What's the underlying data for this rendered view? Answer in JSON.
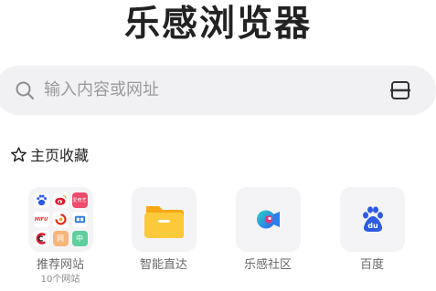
{
  "app": {
    "brand": "乐感浏览器"
  },
  "search": {
    "placeholder": "输入内容或网址",
    "search_icon": "search-icon",
    "scan_icon": "scan-icon"
  },
  "favorites": {
    "title": "主页收藏",
    "icon": "star-outline-icon",
    "items": [
      {
        "label": "推荐网站",
        "sublabel": "10个网站",
        "icon": "site-grid-icon",
        "mini_icons": [
          "baidu-mini-icon",
          "weibo-mini-icon",
          "iqiyi-mini-icon",
          "mini-site-icon",
          "mini-site-icon",
          "mini-site-icon",
          "mini-site-icon",
          "mini-site-icon",
          "mini-site-icon"
        ],
        "mini_texts": {
          "iqiyi": "爱奇艺",
          "mini4": "MIFU",
          "m8": "网",
          "m9": "中"
        }
      },
      {
        "label": "智能直达",
        "icon": "folder-icon"
      },
      {
        "label": "乐感社区",
        "icon": "community-icon"
      },
      {
        "label": "百度",
        "icon": "baidu-paw-icon"
      }
    ]
  },
  "colors": {
    "background": "#ffffff",
    "search_bg": "#f1f1f3",
    "tile_bg": "#f4f4f6",
    "baidu_blue": "#2d5be3",
    "folder_yellow": "#fbc02d",
    "community_blue": "#2d7cf0"
  }
}
